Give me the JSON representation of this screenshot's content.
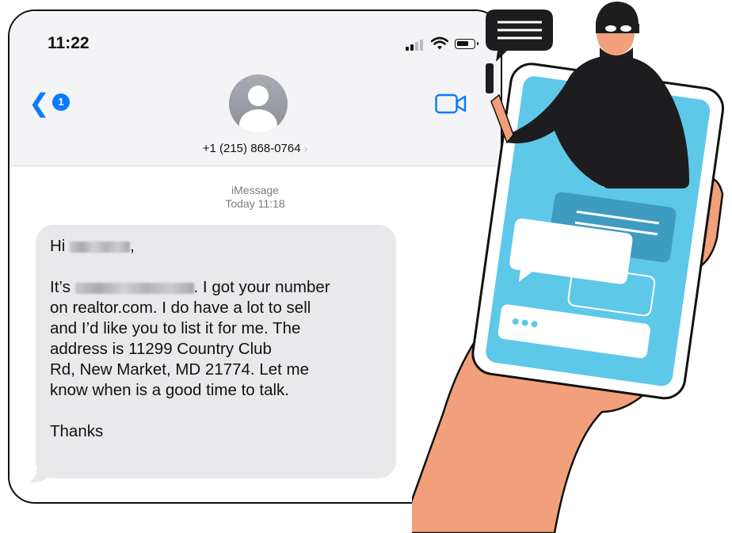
{
  "status_bar": {
    "time": "11:22"
  },
  "header": {
    "back_badge": "1",
    "back_icon": "chevron-left-icon",
    "contact": "+1 (215) 868-0764",
    "contact_chevron": "›"
  },
  "meta": {
    "service": "iMessage",
    "timestamp": "Today 11:18"
  },
  "message": {
    "greeting_prefix": "Hi",
    "greeting_suffix": ",",
    "line1_prefix": "It’s",
    "line1_suffix": ". I got your number",
    "body_lines": [
      "on realtor.com. I do have a lot to sell",
      "and I’d like you to list it for me. The",
      "address is 11299 Country Club",
      "Rd, New Market, MD 21774. Let me",
      "know when is a good time to talk."
    ],
    "signoff": "Thanks"
  },
  "colors": {
    "ios_blue": "#0a7aff",
    "bubble_gray": "#e9e9eb",
    "phone_screen": "#5ec8e8",
    "skin": "#f2a07b",
    "thief": "#1d1d1f"
  }
}
